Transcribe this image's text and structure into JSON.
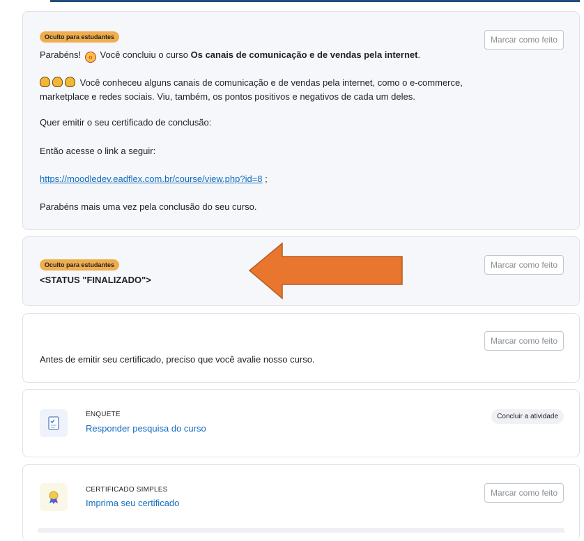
{
  "card1": {
    "badge": "Oculto para estudantes",
    "mark_done": "Marcar como feito",
    "congrats_prefix": "Parabéns!",
    "congrats_mid": "Você concluiu o curso",
    "course_name": "Os canais de comunicação e de vendas pela internet",
    "course_suffix": ".",
    "para1_line1": "Você conheceu alguns canais de comunicação e de vendas pela internet, como o e-commerce,",
    "para1_line2": "marketplace e redes sociais. Viu, também, os pontos positivos e negativos de cada um deles.",
    "question": "Quer emitir o seu certificado de conclusão:",
    "access": "Então acesse o link a seguir:",
    "link": "https://moodledev.eadflex.com.br/course/view.php?id=8",
    "link_suffix": " ;",
    "closing": "Parabéns mais uma vez pela conclusão do seu curso."
  },
  "card2": {
    "badge": "Oculto para estudantes",
    "status": "<STATUS \"FINALIZADO\">",
    "mark_done": "Marcar como feito"
  },
  "card3": {
    "mark_done": "Marcar como feito",
    "text": "Antes de emitir seu certificado, preciso que você avalie nosso curso."
  },
  "card4": {
    "type": "ENQUETE",
    "title": "Responder pesquisa do curso",
    "action": "Concluir a atividade",
    "icon": "survey-icon"
  },
  "card5": {
    "type": "CERTIFICADO SIMPLES",
    "title": "Imprima seu certificado",
    "mark_done": "Marcar como feito",
    "icon": "certificate-icon"
  },
  "colors": {
    "badge": "#f0ad4e",
    "link": "#0f6cbf",
    "arrow": "#e8762e",
    "hidden_card_bg": "#f5f7fb"
  }
}
